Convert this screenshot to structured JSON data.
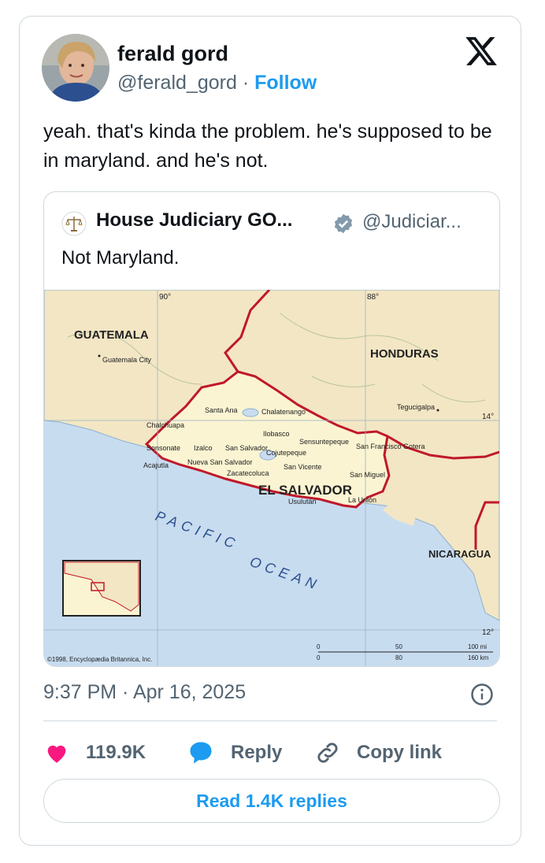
{
  "author": {
    "name": "ferald gord",
    "handle": "@ferald_gord",
    "separator": "·",
    "follow_label": "Follow"
  },
  "tweet": {
    "text": "yeah. that's kinda the problem. he's supposed to be in maryland. and he's not."
  },
  "quoted": {
    "name": "House Judiciary GO...",
    "handle": "@Judiciar...",
    "text": "Not Maryland.",
    "map": {
      "countries": [
        "GUATEMALA",
        "HONDURAS",
        "EL SALVADOR",
        "NICARAGUA"
      ],
      "ocean": [
        "PACIFIC",
        "OCEAN"
      ],
      "cities": [
        "Guatemala City",
        "Tegucigalpa",
        "Santa Ana",
        "Chalatenango",
        "Chalchuapa",
        "Ilobasco",
        "Sonsonate",
        "Izalco",
        "San Salvador",
        "Sensuntepeque",
        "San Francisco Gotera",
        "Cojutepeque",
        "Acajutla",
        "Nueva San Salvador",
        "Zacatecoluca",
        "San Vicente",
        "San Miguel",
        "Usulután",
        "La Unión"
      ],
      "longitudes": [
        "90°",
        "88°"
      ],
      "latitudes": [
        "14°",
        "12°"
      ],
      "scale": {
        "zero": "0",
        "mi_mid": "50",
        "mi_end": "100 mi",
        "km_mid": "80",
        "km_end": "160 km"
      },
      "copyright": "©1998, Encyclopædia Britannica, Inc."
    }
  },
  "meta": {
    "timestamp": "9:37 PM · Apr 16, 2025"
  },
  "actions": {
    "likes": "119.9K",
    "reply": "Reply",
    "copy_link": "Copy link",
    "read_replies": "Read 1.4K replies"
  },
  "colors": {
    "like": "#f91880",
    "link": "#1d9bf0",
    "muted": "#536471",
    "land": "#f3e6c4",
    "salvador": "#fbf4d2",
    "border": "#c0182b",
    "water": "#c8dcf0"
  }
}
